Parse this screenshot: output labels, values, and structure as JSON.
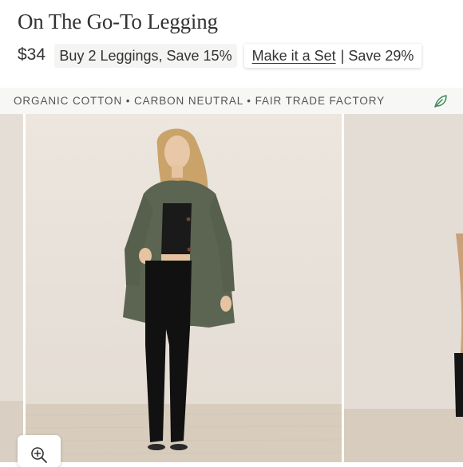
{
  "product": {
    "title": "On The Go-To Legging",
    "price": "$34"
  },
  "offers": {
    "bundle_label": "Buy 2 Leggings, Save 15%",
    "set_link": "Make it a Set",
    "set_separator": "|",
    "set_savings": "Save 29%"
  },
  "attributes_bar": {
    "text": "ORGANIC COTTON • CARBON NEUTRAL • FAIR TRADE FACTORY",
    "icon": "leaf-icon",
    "icon_color": "#3f8a5a"
  },
  "gallery": {
    "images": [
      {
        "name": "previous-product-image"
      },
      {
        "name": "model-wearing-legging-with-green-jacket"
      },
      {
        "name": "next-product-image"
      }
    ],
    "zoom_icon": "zoom-in-icon"
  }
}
